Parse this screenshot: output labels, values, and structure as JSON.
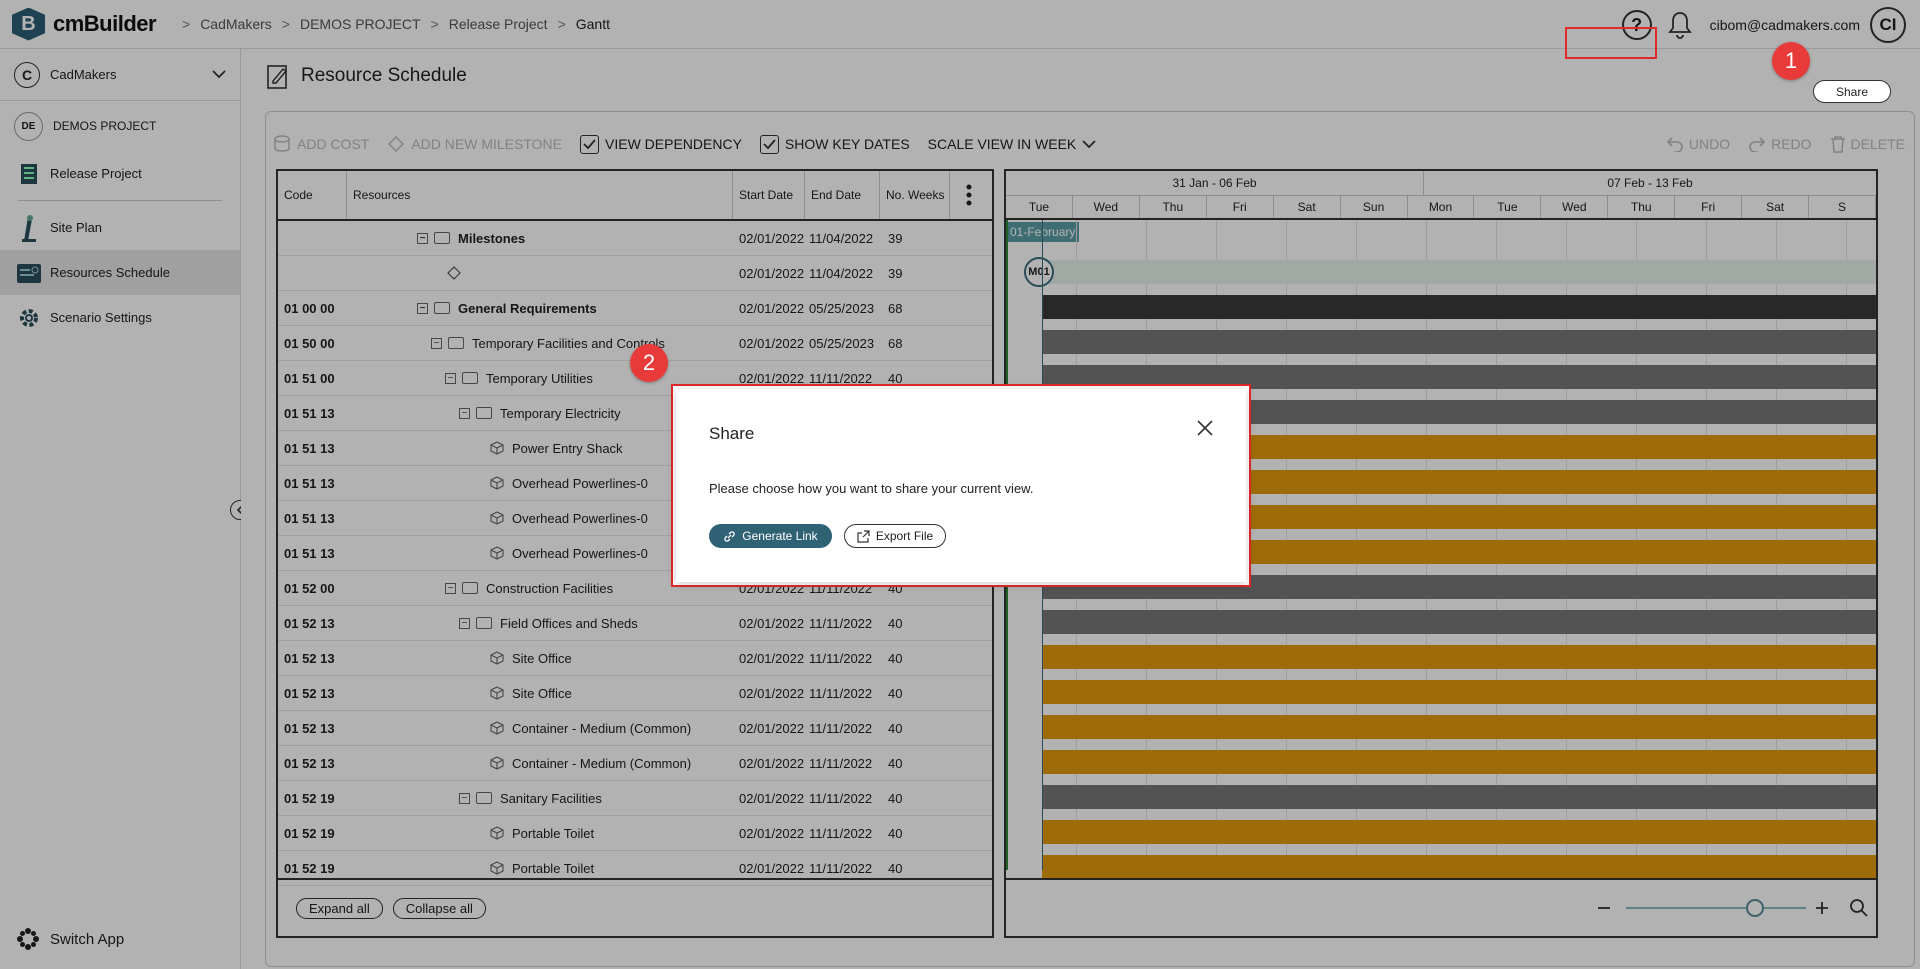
{
  "header": {
    "app_name": "cmBuilder",
    "logo_letter": "B",
    "breadcrumb": [
      "CadMakers",
      "DEMOS PROJECT",
      "Release Project",
      "Gantt"
    ],
    "user_email": "cibom@cadmakers.com",
    "user_initials": "CI"
  },
  "sidebar": {
    "org": {
      "initial": "C",
      "name": "CadMakers"
    },
    "project": {
      "initials": "DE",
      "name": "DEMOS PROJECT"
    },
    "items": [
      {
        "label": "Release Project",
        "icon": "building-icon"
      },
      {
        "label": "Site Plan",
        "icon": "crane-icon"
      },
      {
        "label": "Resources Schedule",
        "icon": "schedule-icon",
        "active": true
      },
      {
        "label": "Scenario Settings",
        "icon": "gear-icon"
      }
    ],
    "switch_app": "Switch App"
  },
  "page": {
    "title": "Resource Schedule",
    "share_label": "Share"
  },
  "badges": {
    "one": "1",
    "two": "2"
  },
  "toolbar": {
    "add_cost": "ADD COST",
    "add_milestone": "ADD NEW MILESTONE",
    "view_dependency": "VIEW DEPENDENCY",
    "show_key_dates": "SHOW KEY DATES",
    "scale_view": "SCALE VIEW IN WEEK",
    "undo": "UNDO",
    "redo": "REDO",
    "delete": "DELETE"
  },
  "grid": {
    "columns": {
      "code": "Code",
      "resources": "Resources",
      "start": "Start Date",
      "end": "End Date",
      "weeks": "No. Weeks"
    },
    "rows": [
      {
        "code": "",
        "name": "Milestones",
        "start": "02/01/2022",
        "end": "11/04/2022",
        "weeks": "39"
      },
      {
        "code": "",
        "name": "",
        "start": "02/01/2022",
        "end": "11/04/2022",
        "weeks": "39"
      },
      {
        "code": "01 00 00",
        "name": "General Requirements",
        "start": "02/01/2022",
        "end": "05/25/2023",
        "weeks": "68"
      },
      {
        "code": "01 50 00",
        "name": "Temporary Facilities and Controls",
        "start": "02/01/2022",
        "end": "05/25/2023",
        "weeks": "68"
      },
      {
        "code": "01 51 00",
        "name": "Temporary Utilities",
        "start": "02/01/2022",
        "end": "11/11/2022",
        "weeks": "40"
      },
      {
        "code": "01 51 13",
        "name": "Temporary Electricity",
        "start": "",
        "end": "",
        "weeks": ""
      },
      {
        "code": "01 51 13",
        "name": "Power Entry Shack",
        "start": "",
        "end": "",
        "weeks": ""
      },
      {
        "code": "01 51 13",
        "name": "Overhead Powerlines-0",
        "start": "",
        "end": "",
        "weeks": ""
      },
      {
        "code": "01 51 13",
        "name": "Overhead Powerlines-0",
        "start": "",
        "end": "",
        "weeks": ""
      },
      {
        "code": "01 51 13",
        "name": "Overhead Powerlines-0",
        "start": "",
        "end": "",
        "weeks": ""
      },
      {
        "code": "01 52 00",
        "name": "Construction Facilities",
        "start": "02/01/2022",
        "end": "11/11/2022",
        "weeks": "40"
      },
      {
        "code": "01 52 13",
        "name": "Field Offices and Sheds",
        "start": "02/01/2022",
        "end": "11/11/2022",
        "weeks": "40"
      },
      {
        "code": "01 52 13",
        "name": "Site Office",
        "start": "02/01/2022",
        "end": "11/11/2022",
        "weeks": "40"
      },
      {
        "code": "01 52 13",
        "name": "Site Office",
        "start": "02/01/2022",
        "end": "11/11/2022",
        "weeks": "40"
      },
      {
        "code": "01 52 13",
        "name": "Container - Medium (Common)",
        "start": "02/01/2022",
        "end": "11/11/2022",
        "weeks": "40"
      },
      {
        "code": "01 52 13",
        "name": "Container - Medium (Common)",
        "start": "02/01/2022",
        "end": "11/11/2022",
        "weeks": "40"
      },
      {
        "code": "01 52 19",
        "name": "Sanitary Facilities",
        "start": "02/01/2022",
        "end": "11/11/2022",
        "weeks": "40"
      },
      {
        "code": "01 52 19",
        "name": "Portable Toilet",
        "start": "02/01/2022",
        "end": "11/11/2022",
        "weeks": "40"
      },
      {
        "code": "01 52 19",
        "name": "Portable Toilet",
        "start": "02/01/2022",
        "end": "11/11/2022",
        "weeks": "40"
      }
    ],
    "expand_all": "Expand all",
    "collapse_all": "Collapse all"
  },
  "gantt": {
    "weeks": [
      "31 Jan - 06 Feb",
      "07 Feb - 13 Feb"
    ],
    "days": [
      "Tue",
      "Wed",
      "Thu",
      "Fri",
      "Sat",
      "Sun",
      "Mon",
      "Tue",
      "Wed",
      "Thu",
      "Fri",
      "Sat",
      "S"
    ],
    "month_tag": "01-February",
    "milestone": "M01",
    "colors": {
      "dark": "#3a3a3a",
      "gray": "#777777",
      "orange": "#e29a0e"
    }
  },
  "modal": {
    "title": "Share",
    "message": "Please choose how you want to share your current view.",
    "generate_link": "Generate Link",
    "export_file": "Export File"
  }
}
